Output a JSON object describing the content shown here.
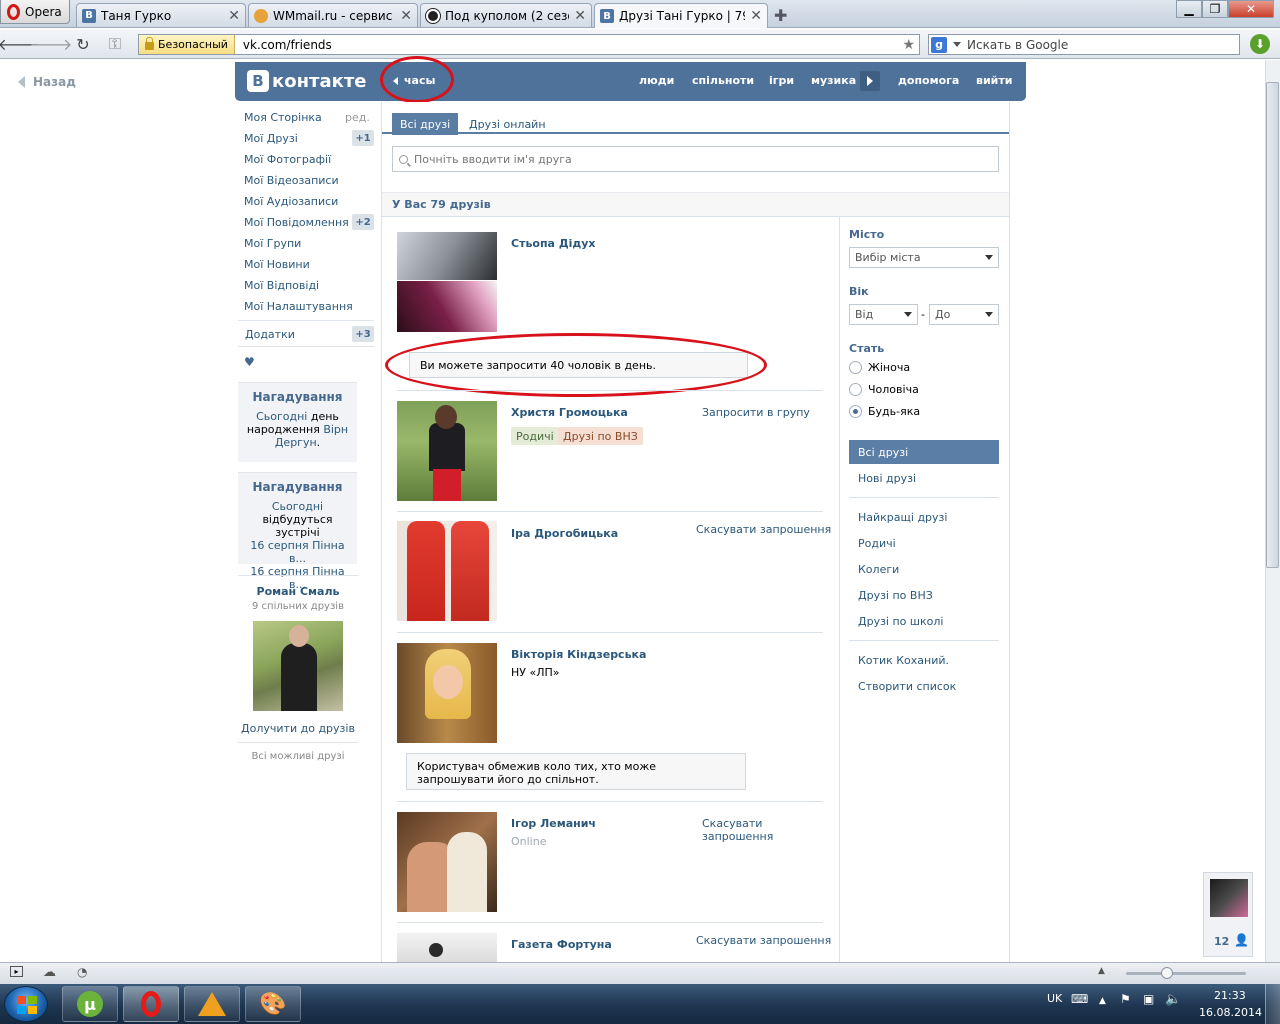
{
  "browser": {
    "menu_label": "Opera",
    "tabs": [
      {
        "title": "Таня Гурко",
        "icon": "vk-favicon"
      },
      {
        "title": "WMmail.ru - сервис п...",
        "icon": "wmmail-favicon"
      },
      {
        "title": "Под куполом (2 сезон...",
        "icon": "dome-favicon"
      },
      {
        "title": "Друзі Тані Гурко | 79 д...",
        "icon": "vk-favicon",
        "active": true
      }
    ],
    "security_label": "Безопасный",
    "url": "vk.com/friends",
    "search_placeholder": "Искать в Google"
  },
  "page": {
    "back_label": "Назад",
    "header": {
      "logo_text": "контакте",
      "logo_letter": "В",
      "back_link": "часы",
      "nav": [
        "люди",
        "спільноти",
        "ігри",
        "музика",
        "допомога",
        "вийти"
      ]
    },
    "left_menu": {
      "items": [
        {
          "label": "Моя Сторінка",
          "extra": "ред."
        },
        {
          "label": "Мої Друзі",
          "badge": "+1"
        },
        {
          "label": "Мої Фотографії"
        },
        {
          "label": "Мої Відеозаписи"
        },
        {
          "label": "Мої Аудіозаписи"
        },
        {
          "label": "Мої Повідомлення",
          "badge": "+2"
        },
        {
          "label": "Мої Групи"
        },
        {
          "label": "Мої Новини"
        },
        {
          "label": "Мої Відповіді"
        },
        {
          "label": "Мої Налаштування"
        },
        {
          "label": "Додатки",
          "badge": "+3"
        }
      ],
      "heart": "♥"
    },
    "reminders": [
      {
        "title": "Нагадування",
        "line1_link": "Сьогодні",
        "line1_text": " день народження ",
        "line1_link2": "Вірн Дергун",
        "line1_end": "."
      },
      {
        "title": "Нагадування",
        "line1_link": "Сьогодні",
        "line1_text": "відбудуться зустрічі",
        "line2": "16 серпня Пінна в...",
        "line3": "16 серпня Пінна в..."
      }
    ],
    "suggestion": {
      "name": "Роман Смаль",
      "mutual": "9 спільних друзів",
      "add_label": "Долучити до друзів",
      "all_label": "Всі можливі друзі"
    },
    "tabs": [
      "Всі друзі",
      "Друзі онлайн"
    ],
    "search_placeholder": "Почніть вводити ім'я друга",
    "friends_count": "У Вас 79 друзів",
    "invite_notice": "Ви можете запросити 40 чоловік в день.",
    "restricted_notice": "Користувач обмежив коло тих, хто може запрошувати його до спільнот.",
    "friends": [
      {
        "name": "Стьопа Дідух"
      },
      {
        "name": "Христя Громоцька",
        "action": "Запросити в групу",
        "tags": [
          "Родичі",
          "Друзі по ВНЗ"
        ]
      },
      {
        "name": "Іра Дрогобицька",
        "action": "Скасувати запрошення"
      },
      {
        "name": "Вікторія Кіндзерська",
        "sub": "НУ «ЛП»"
      },
      {
        "name": "Ігор Леманич",
        "sub": "Online",
        "action": "Скасувати запрошення"
      },
      {
        "name": "Газета Фортуна",
        "action": "Скасувати запрошення"
      }
    ],
    "filters": {
      "city_label": "Місто",
      "city_value": "Вибір міста",
      "age_label": "Вік",
      "age_from": "Від",
      "age_to": "До",
      "age_dash": "-",
      "sex_label": "Стать",
      "sex_options": [
        "Жіноча",
        "Чоловіча",
        "Будь-яка"
      ],
      "sex_selected": "Будь-яка"
    },
    "right_menu": {
      "group1": [
        "Всі друзі",
        "Нові друзі"
      ],
      "group2": [
        "Найкращі друзі",
        "Родичі",
        "Колеги",
        "Друзі по ВНЗ",
        "Друзі по школі"
      ],
      "group3": [
        "Котик Коханий.",
        "Створити список"
      ]
    },
    "chat_count": "12"
  },
  "taskbar": {
    "lang": "UK",
    "time": "21:33",
    "date": "16.08.2014"
  },
  "colors": {
    "vk_blue": "#4e729a",
    "link": "#2b587a",
    "annotation_red": "#d7121b"
  }
}
